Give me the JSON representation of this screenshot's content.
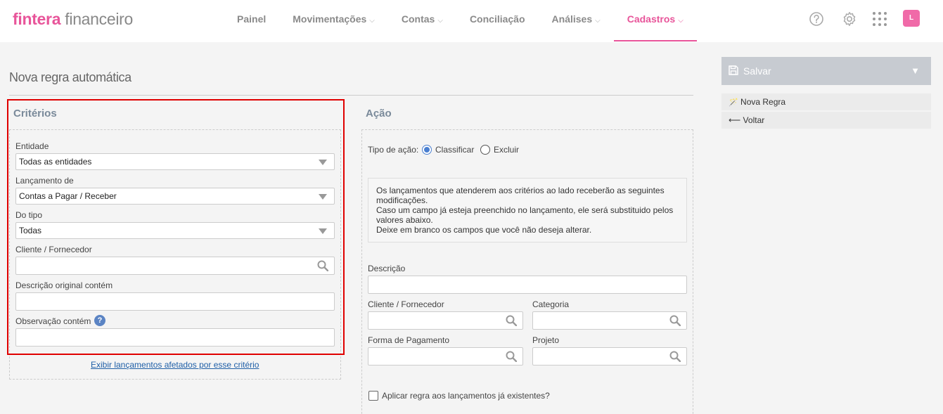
{
  "brand": {
    "bold": "fintera",
    "light": " financeiro"
  },
  "nav": {
    "items": [
      {
        "label": "Painel",
        "has_dropdown": false,
        "active": false
      },
      {
        "label": "Movimentações",
        "has_dropdown": true,
        "active": false
      },
      {
        "label": "Contas",
        "has_dropdown": true,
        "active": false
      },
      {
        "label": "Conciliação",
        "has_dropdown": false,
        "active": false
      },
      {
        "label": "Análises",
        "has_dropdown": true,
        "active": false
      },
      {
        "label": "Cadastros",
        "has_dropdown": true,
        "active": true
      }
    ],
    "chevron": "⌵",
    "icons": [
      "help-icon",
      "gear-icon",
      "apps-grid-icon"
    ],
    "avatar_letter": "L"
  },
  "page": {
    "title": "Nova regra automática"
  },
  "criterios": {
    "title": "Critérios",
    "entidade_label": "Entidade",
    "entidade_value": "Todas as entidades",
    "lancamento_label": "Lançamento de",
    "lancamento_value": "Contas a Pagar / Receber",
    "tipo_label": "Do tipo",
    "tipo_value": "Todas",
    "cliente_label": "Cliente / Fornecedor",
    "cliente_value": "",
    "descricao_label": "Descrição original contém",
    "descricao_value": "",
    "observacao_label": "Observação contém",
    "observacao_value": "",
    "help_glyph": "?",
    "link": "Exibir lançamentos afetados por esse critério"
  },
  "acao": {
    "title": "Ação",
    "tipo_label": "Tipo de ação:",
    "options": [
      "Classificar",
      "Excluir"
    ],
    "selected": "Classificar",
    "info_lines": [
      "Os lançamentos que atenderem aos critérios ao lado receberão as seguintes modificações.",
      "Caso um campo já esteja preenchido no lançamento, ele será substituido pelos valores abaixo.",
      "Deixe em branco os campos que você não deseja alterar."
    ],
    "descricao_label": "Descrição",
    "cliente_label": "Cliente / Fornecedor",
    "categoria_label": "Categoria",
    "forma_label": "Forma de Pagamento",
    "projeto_label": "Projeto",
    "aplicar_label": "Aplicar regra aos lançamentos já existentes?",
    "aplicar_checked": false
  },
  "sidebar": {
    "save_label": "Salvar",
    "save_arrow": "▼",
    "nova_regra_icon_glyph": "🪄",
    "nova_regra_label": "Nova Regra",
    "voltar_glyph": "⟵",
    "voltar_label": "Voltar"
  },
  "colors": {
    "brand": "#e8559a",
    "highlight": "#e00000",
    "link": "#1f5fa7",
    "radio": "#4a7fd0"
  }
}
